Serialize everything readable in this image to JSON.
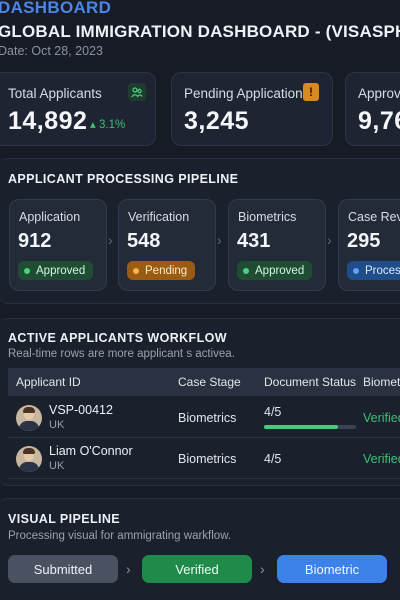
{
  "header": {
    "brand": "DASHBOARD",
    "title": "GLOBAL IMMIGRATION DASHBOARD - (VISASPH",
    "date": "Date: Oct 28, 2023"
  },
  "kpis": [
    {
      "label": "Total Applicants",
      "value": "14,892",
      "delta": "3.1%",
      "icon": "people-icon"
    },
    {
      "label": "Pending Applications",
      "value": "3,245",
      "icon": "warning-icon",
      "warn_glyph": "!"
    },
    {
      "label": "Approve",
      "value": "9,76"
    }
  ],
  "pipeline": {
    "title": "APPLICANT PROCESSING PIPELINE",
    "stages": [
      {
        "label": "Application",
        "count": "912",
        "status": "Approved",
        "tone": "green"
      },
      {
        "label": "Verification",
        "count": "548",
        "status": "Pending",
        "tone": "orange"
      },
      {
        "label": "Biometrics",
        "count": "431",
        "status": "Approved",
        "tone": "green"
      },
      {
        "label": "Case Rev",
        "count": "295",
        "status": "Proces",
        "tone": "blue"
      }
    ]
  },
  "workflow": {
    "title": "ACTIVE APPLICANTS WORKFLOW",
    "subtitle": "Real-time rows are more applicant s activea.",
    "columns": [
      "Applicant ID",
      "Case Stage",
      "Document Status",
      "Biometr"
    ],
    "rows": [
      {
        "id": "VSP-00412",
        "country": "UK",
        "stage": "Biometrics",
        "docs": "4/5",
        "docs_progress": 0.8,
        "bio": "Verified"
      },
      {
        "id": "Liam O'Connor",
        "country": "UK",
        "stage": "Biometrics",
        "docs": "4/5",
        "bio": "Verified"
      }
    ]
  },
  "visual": {
    "title": "VISUAL PIPELINE",
    "subtitle": "Processing visual for ammigrating warkflow.",
    "steps": [
      "Submitted",
      "Verified",
      "Biometric"
    ]
  },
  "colors": {
    "accent_blue": "#4a86e8",
    "success": "#3fbf73",
    "warning": "#d88a1f",
    "background": "#161b26"
  }
}
